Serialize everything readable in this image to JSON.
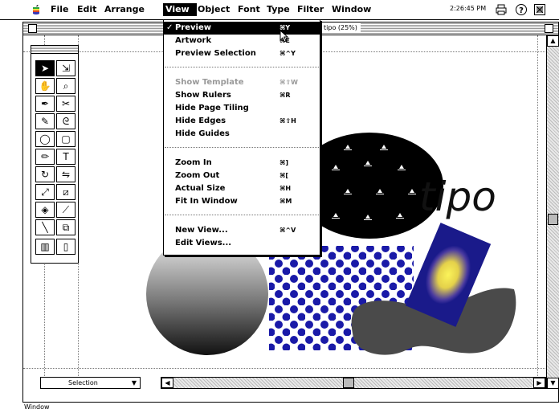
{
  "menubar": {
    "items": [
      {
        "label": "File"
      },
      {
        "label": "Edit"
      },
      {
        "label": "Arrange"
      },
      {
        "label": "View"
      },
      {
        "label": "Object"
      },
      {
        "label": "Font"
      },
      {
        "label": "Type"
      },
      {
        "label": "Filter"
      },
      {
        "label": "Window"
      }
    ],
    "clock": "2:26:45 PM",
    "icons": [
      "apple-icon",
      "printer-icon",
      "help-icon",
      "application-icon"
    ]
  },
  "document_window": {
    "title": "tipo (25%)"
  },
  "view_menu": {
    "items": [
      {
        "label": "Preview",
        "shortcut": "⌘Y",
        "checked": "✓",
        "state": "highlighted"
      },
      {
        "label": "Artwork",
        "shortcut": "⌘E"
      },
      {
        "label": "Preview Selection",
        "shortcut": "⌘^Y"
      },
      {
        "label": "Show Template",
        "shortcut": "⌘⇧W",
        "state": "disabled"
      },
      {
        "label": "Show Rulers",
        "shortcut": "⌘R"
      },
      {
        "label": "Hide Page Tiling",
        "shortcut": ""
      },
      {
        "label": "Hide Edges",
        "shortcut": "⌘⇧H"
      },
      {
        "label": "Hide Guides",
        "shortcut": ""
      },
      {
        "label": "Zoom In",
        "shortcut": "⌘]"
      },
      {
        "label": "Zoom Out",
        "shortcut": "⌘["
      },
      {
        "label": "Actual Size",
        "shortcut": "⌘H"
      },
      {
        "label": "Fit In Window",
        "shortcut": "⌘M"
      },
      {
        "label": "New View...",
        "shortcut": "⌘^V"
      },
      {
        "label": "Edit Views...",
        "shortcut": ""
      }
    ]
  },
  "toolbox": {
    "tools": [
      "selection-arrow-icon",
      "direct-selection-icon",
      "hand-icon",
      "zoom-icon",
      "pen-icon",
      "scissors-icon",
      "freehand-icon",
      "brush-icon",
      "oval-icon",
      "rectangle-icon",
      "pencil-icon",
      "type-icon",
      "rotate-icon",
      "reflect-icon",
      "scale-icon",
      "shear-icon",
      "paint-bucket-icon",
      "eyedropper-icon",
      "measure-icon",
      "blend-icon",
      "graph-icon",
      "page-icon"
    ]
  },
  "artwork": {
    "text": "tipo"
  },
  "bottom_bar": {
    "zoom_label": "Selection"
  },
  "back_window": {
    "title": "Window"
  },
  "colors": {
    "accent_blue": "#1a1aa8",
    "gradient_yellow": "#f7f03a",
    "dark_gray": "#4a4a4a"
  }
}
